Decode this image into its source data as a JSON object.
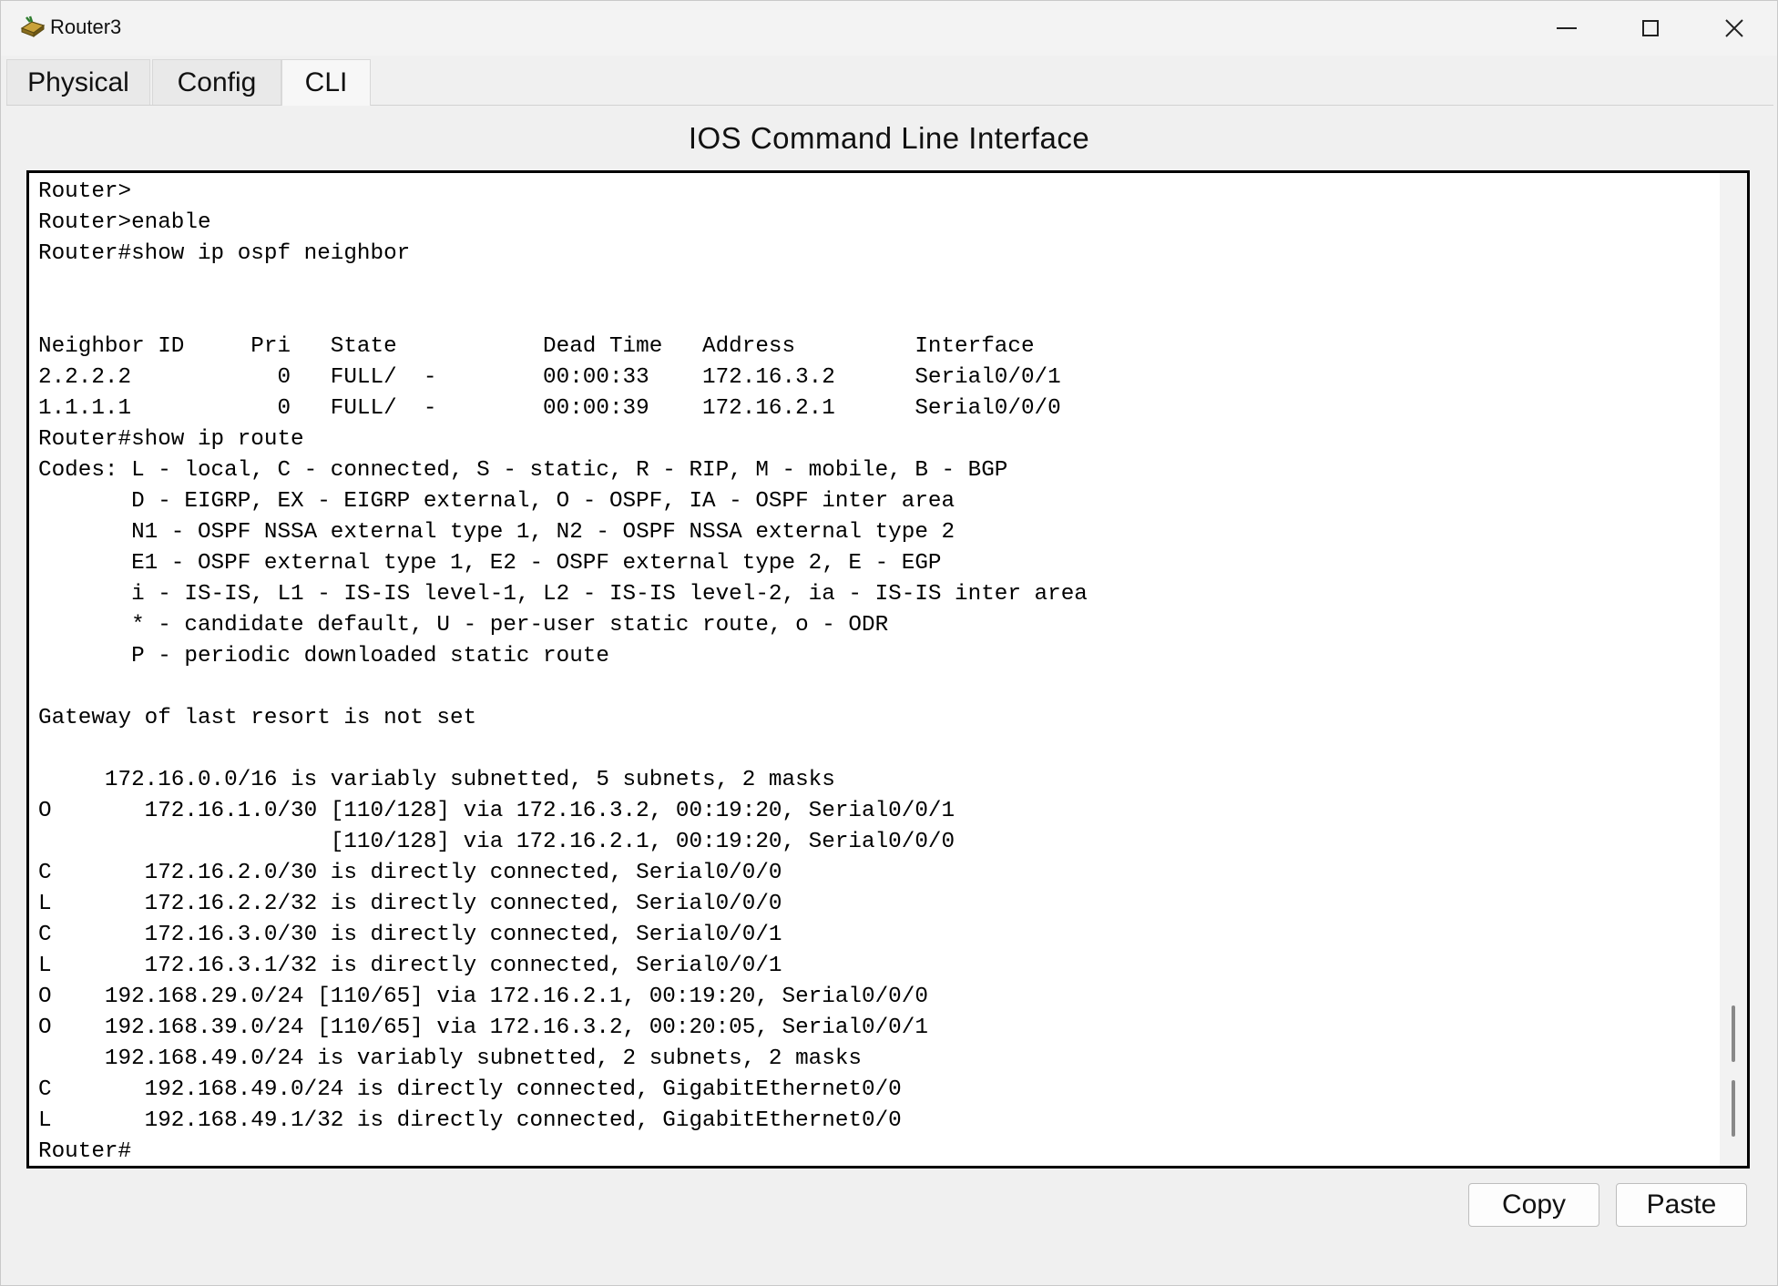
{
  "window": {
    "title": "Router3",
    "icon": "router-icon",
    "controls": {
      "minimize": "minimize-icon",
      "maximize": "maximize-icon",
      "close": "close-icon"
    }
  },
  "tabs": [
    {
      "label": "Physical"
    },
    {
      "label": "Config"
    },
    {
      "label": "CLI",
      "active": true
    }
  ],
  "cli": {
    "heading": "IOS Command Line Interface",
    "lines": [
      "Router>",
      "Router>enable",
      "Router#show ip ospf neighbor",
      "",
      "",
      "Neighbor ID     Pri   State           Dead Time   Address         Interface",
      "2.2.2.2           0   FULL/  -        00:00:33    172.16.3.2      Serial0/0/1",
      "1.1.1.1           0   FULL/  -        00:00:39    172.16.2.1      Serial0/0/0",
      "Router#show ip route",
      "Codes: L - local, C - connected, S - static, R - RIP, M - mobile, B - BGP",
      "       D - EIGRP, EX - EIGRP external, O - OSPF, IA - OSPF inter area",
      "       N1 - OSPF NSSA external type 1, N2 - OSPF NSSA external type 2",
      "       E1 - OSPF external type 1, E2 - OSPF external type 2, E - EGP",
      "       i - IS-IS, L1 - IS-IS level-1, L2 - IS-IS level-2, ia - IS-IS inter area",
      "       * - candidate default, U - per-user static route, o - ODR",
      "       P - periodic downloaded static route",
      "",
      "Gateway of last resort is not set",
      "",
      "     172.16.0.0/16 is variably subnetted, 5 subnets, 2 masks",
      "O       172.16.1.0/30 [110/128] via 172.16.3.2, 00:19:20, Serial0/0/1",
      "                      [110/128] via 172.16.2.1, 00:19:20, Serial0/0/0",
      "C       172.16.2.0/30 is directly connected, Serial0/0/0",
      "L       172.16.2.2/32 is directly connected, Serial0/0/0",
      "C       172.16.3.0/30 is directly connected, Serial0/0/1",
      "L       172.16.3.1/32 is directly connected, Serial0/0/1",
      "O    192.168.29.0/24 [110/65] via 172.16.2.1, 00:19:20, Serial0/0/0",
      "O    192.168.39.0/24 [110/65] via 172.16.3.2, 00:20:05, Serial0/0/1",
      "     192.168.49.0/24 is variably subnetted, 2 subnets, 2 masks",
      "C       192.168.49.0/24 is directly connected, GigabitEthernet0/0",
      "L       192.168.49.1/32 is directly connected, GigabitEthernet0/0",
      "Router#"
    ]
  },
  "buttons": {
    "copy": "Copy",
    "paste": "Paste"
  }
}
